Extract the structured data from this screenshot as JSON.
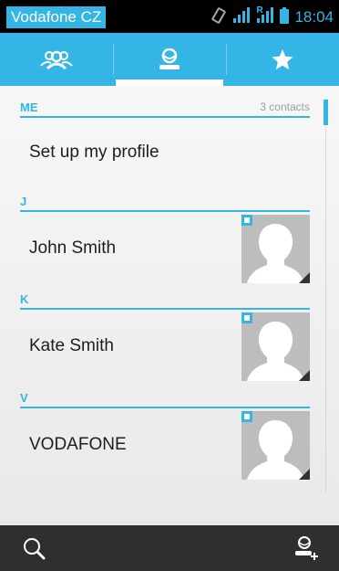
{
  "status_bar": {
    "carrier": "Vodafone CZ",
    "signal_badge": "R",
    "time": "18:04",
    "icons": [
      "vibrate-icon",
      "signal-icon",
      "roaming-signal-icon",
      "battery-icon"
    ]
  },
  "tabs": [
    {
      "name": "groups",
      "icon": "groups-icon",
      "active": false
    },
    {
      "name": "contacts",
      "icon": "person-icon",
      "active": true
    },
    {
      "name": "favorites",
      "icon": "star-icon",
      "active": false
    }
  ],
  "list": {
    "me_header": "ME",
    "contact_count": "3 contacts",
    "profile_text": "Set up my profile",
    "sections": [
      {
        "letter": "J",
        "name": "John Smith"
      },
      {
        "letter": "K",
        "name": "Kate Smith"
      },
      {
        "letter": "V",
        "name": "VODAFONE"
      }
    ]
  },
  "bottom_bar": {
    "left_icon": "search-icon",
    "right_icon": "add-contact-icon"
  },
  "colors": {
    "accent": "#33b5e5",
    "bottom_bar": "#2f2f2f",
    "status_bar": "#000000",
    "photo_placeholder": "#bdbdbd"
  }
}
